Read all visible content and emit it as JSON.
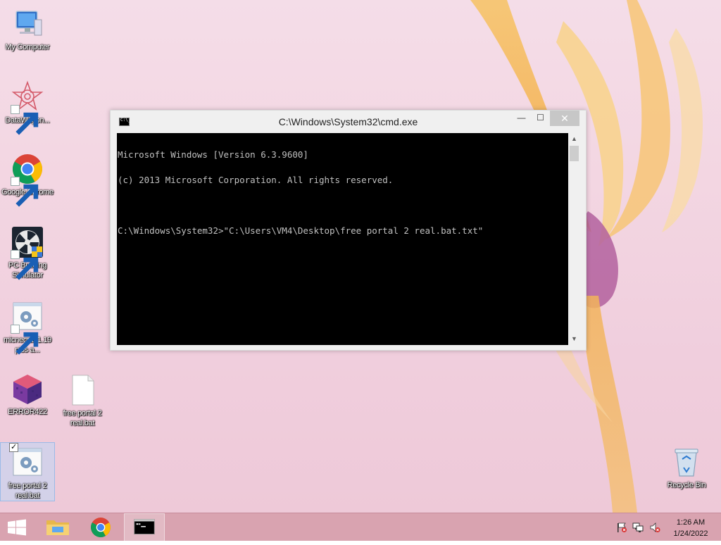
{
  "desktop_icons": [
    {
      "id": "my-computer",
      "label": "My Computer"
    },
    {
      "id": "datawagon",
      "label": "DataWagon..."
    },
    {
      "id": "google-chrome",
      "label": "Google Chrome"
    },
    {
      "id": "pc-building-simulator",
      "label": "PC Building Simulator"
    },
    {
      "id": "minecraft-shortcut",
      "label": "micnecraf 1.19 piss a..."
    },
    {
      "id": "error422",
      "label": "ERROR422"
    },
    {
      "id": "free-portal-2-txt",
      "label": "free portal 2 real.bat"
    },
    {
      "id": "free-portal-2-bat",
      "label": "free portal 2 real.bat"
    },
    {
      "id": "recycle-bin",
      "label": "Recycle Bin"
    }
  ],
  "cmd_window": {
    "title": "C:\\Windows\\System32\\cmd.exe",
    "icon_text": "C:\\_",
    "minimize_symbol": "—",
    "maximize_symbol": "☐",
    "close_symbol": "✕",
    "console_lines": [
      "Microsoft Windows [Version 6.3.9600]",
      "(c) 2013 Microsoft Corporation. All rights reserved.",
      "",
      "C:\\Windows\\System32>\"C:\\Users\\VM4\\Desktop\\free portal 2 real.bat.txt\""
    ],
    "scroll_up_symbol": "▲",
    "scroll_down_symbol": "▼"
  },
  "taskbar": {
    "items": [
      {
        "id": "start",
        "icon": "windows-logo-icon"
      },
      {
        "id": "file-explorer",
        "icon": "folder-icon"
      },
      {
        "id": "chrome",
        "icon": "chrome-icon"
      },
      {
        "id": "cmd",
        "icon": "cmd-icon"
      }
    ],
    "tray": {
      "icons": [
        "action-center-flag-icon",
        "network-icon",
        "volume-muted-icon"
      ],
      "time": "1:26 AM",
      "date": "1/24/2022"
    }
  },
  "colors": {
    "console_bg": "#000000",
    "console_text": "#c0c0c0",
    "taskbar": "#d9a3b0",
    "close_button": "#c7c7c7"
  }
}
